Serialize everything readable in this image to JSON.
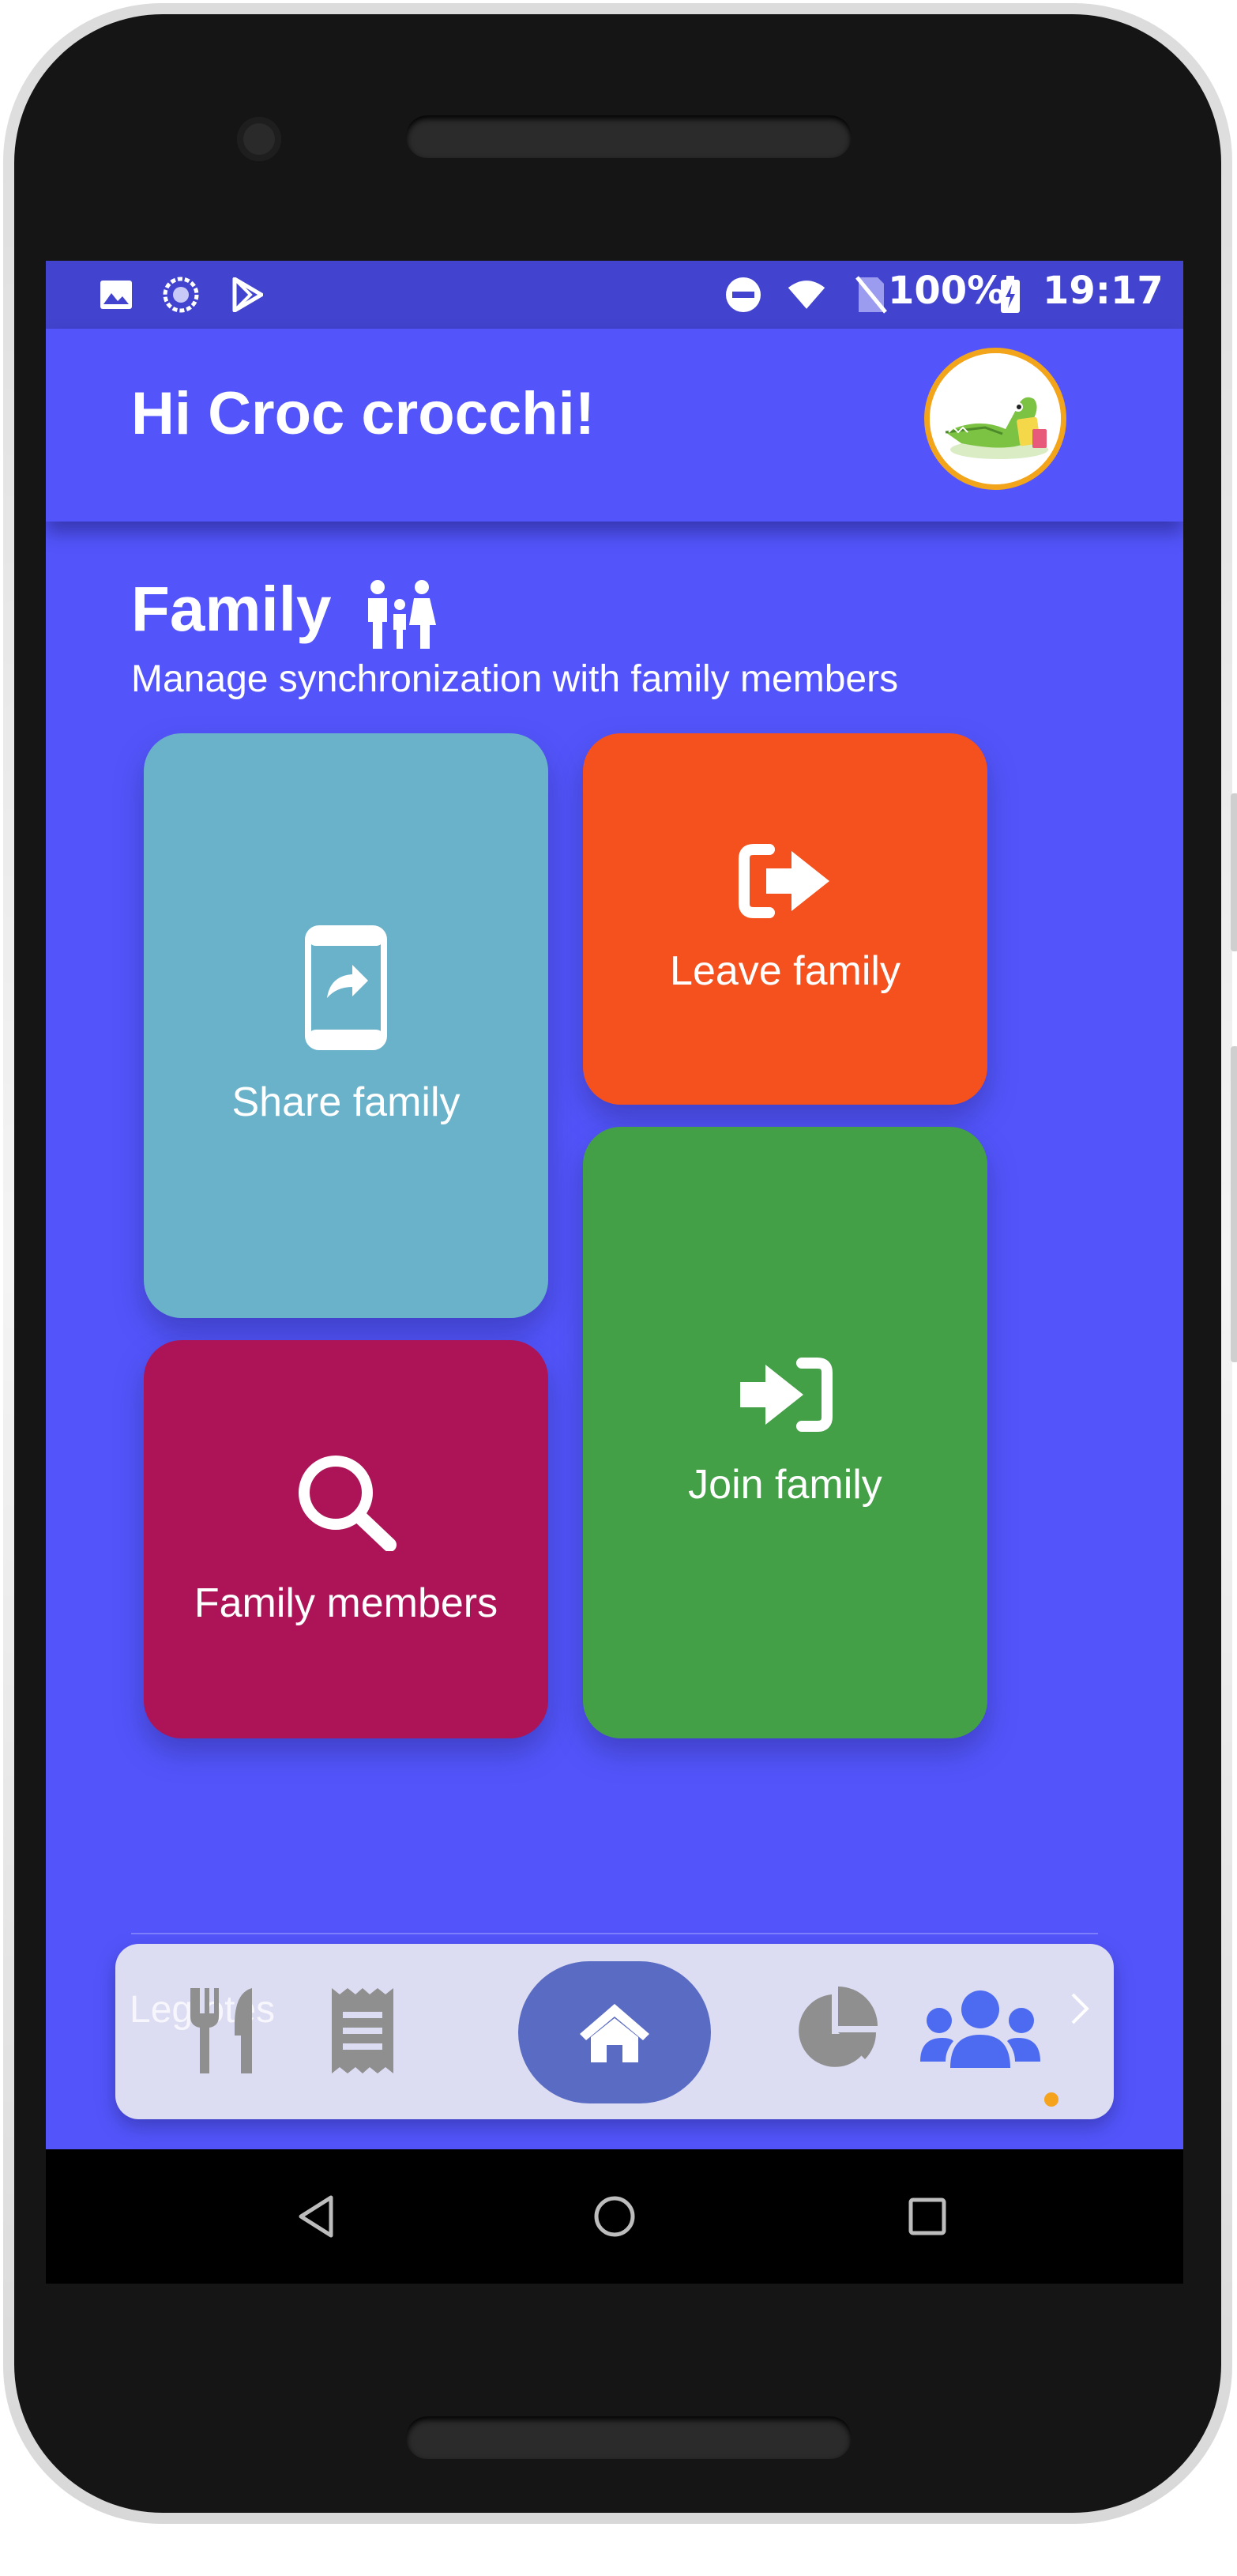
{
  "status_bar": {
    "battery": "100%",
    "time": "19:17",
    "icons_left": [
      "image-icon",
      "sync-icon",
      "play-store-icon"
    ],
    "icons_right": [
      "dnd-icon",
      "wifi-icon",
      "no-sim-icon",
      "battery-charging-icon"
    ]
  },
  "header": {
    "greeting": "Hi Croc crocchi!",
    "avatar": "crocodile-avatar"
  },
  "section": {
    "title": "Family",
    "subtitle": "Manage synchronization with family members",
    "icon": "family-icon"
  },
  "tiles": {
    "share": {
      "label": "Share family",
      "icon": "phone-share-icon",
      "color": "#69b2c9"
    },
    "leave": {
      "label": "Leave family",
      "icon": "sign-out-icon",
      "color": "#f4511e"
    },
    "members": {
      "label": "Family members",
      "icon": "search-icon",
      "color": "#ad1457"
    },
    "join": {
      "label": "Join family",
      "icon": "sign-in-icon",
      "color": "#43a047"
    }
  },
  "bottom_nav": {
    "hint_text": "Leg      otes",
    "items": [
      "fork-knife-icon",
      "receipt-icon",
      "home-icon",
      "pie-chart-icon",
      "users-icon"
    ],
    "active": "users-icon",
    "accent": "#5a6bc3",
    "active_color": "#4d6bf0"
  },
  "colors": {
    "background": "#5355fb",
    "status_bar": "#4244cf"
  }
}
